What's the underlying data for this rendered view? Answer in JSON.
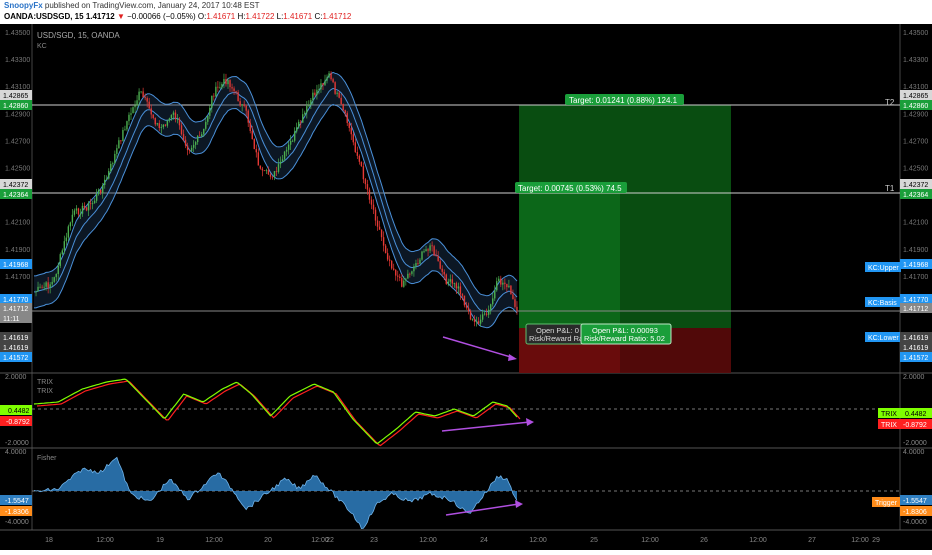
{
  "header": {
    "author": "SnoopyFx",
    "published": "published on TradingView.com, January 24, 2017 10:48 EST",
    "symbol": "OANDA:USDSGD, 15",
    "last": "1.41712",
    "change": "−0.00066 (−0.05%)",
    "ohlc": {
      "o_label": "O:",
      "o": "1.41671",
      "h_label": "H:",
      "h": "1.41722",
      "l_label": "L:",
      "l": "1.41671",
      "c_label": "C:",
      "c": "1.41712"
    }
  },
  "main_pane": {
    "symbol_label": "USD/SGD, 15, OANDA",
    "indicator_label": "KC",
    "target_t2": "Target: 0.01241 (0.88%) 124.1",
    "target_t1": "Target: 0.00745 (0.53%) 74.5",
    "line_label_t2": "T2",
    "line_label_t1": "T1",
    "open_pnl_1": "Open P&L: 0",
    "rr_1": "Risk/Reward Ra",
    "open_pnl_2": "Open P&L: 0.00093",
    "rr_2": "Risk/Reward Ratio: 5.02",
    "kc_upper": "KC:Upper",
    "kc_basis": "KC:Basis",
    "kc_lower": "KC:Lower",
    "left_axis_ticks": [
      "1.43500",
      "1.43300",
      "1.43100",
      "1.42900",
      "1.42700",
      "1.42500",
      "1.42300",
      "1.42100",
      "1.41900",
      "1.41700",
      "1.41500"
    ],
    "right_axis_ticks": [
      "1.43500",
      "1.43300",
      "1.43100",
      "1.42900",
      "1.42700",
      "1.42500",
      "1.42300",
      "1.42100",
      "1.41900",
      "1.41700",
      "1.41500"
    ],
    "left_labels": [
      "1.42865",
      "1.42860",
      "1.42372",
      "1.42364",
      "1.41968",
      "1.41770",
      "1.41712",
      "11:11",
      "1.41619",
      "1.41619",
      "1.41572"
    ],
    "right_labels": [
      "1.42865",
      "1.42860",
      "1.42372",
      "1.42364",
      "1.41968",
      "1.41770",
      "1.41712",
      "1.41619",
      "1.41619",
      "1.41572"
    ]
  },
  "trix_pane": {
    "label_1": "TRIX",
    "label_2": "TRIX",
    "left_ticks": [
      "2.0000",
      "-2.0000"
    ],
    "right_ticks": [
      "2.0000",
      "-2.0000"
    ],
    "left_labels": [
      "0.4482",
      "-0.8792"
    ],
    "right_labels": [
      "0.4482",
      "-0.8792"
    ],
    "legend": [
      "TRIX",
      "TRIX"
    ]
  },
  "fisher_pane": {
    "label": "Fisher",
    "left_ticks": [
      "4.0000",
      "-4.0000"
    ],
    "right_ticks": [
      "4.0000",
      "-4.0000"
    ],
    "left_labels": [
      "-1.5547",
      "-1.8306"
    ],
    "right_labels": [
      "-1.5547",
      "-1.8306"
    ],
    "legend": "Trigger"
  },
  "x_axis": [
    "18",
    "12:00",
    "19",
    "12:00",
    "20",
    "12:00",
    "22",
    "23",
    "12:00",
    "24",
    "12:00",
    "25",
    "12:00",
    "26",
    "12:00",
    "27",
    "12:00",
    "29"
  ],
  "colors": {
    "up": "#4caf50",
    "down": "#e53935",
    "keltner": "#4a90d9",
    "long_green": "#0a5a14",
    "stop_red": "#5a0a0a",
    "trix_green": "#7fff00",
    "trix_red": "#ff2020",
    "fisher_fill": "#2f7fc1",
    "divergence": "#b04fe0",
    "badge_blue": "#2196f3",
    "badge_green": "#1a9e3a"
  }
}
